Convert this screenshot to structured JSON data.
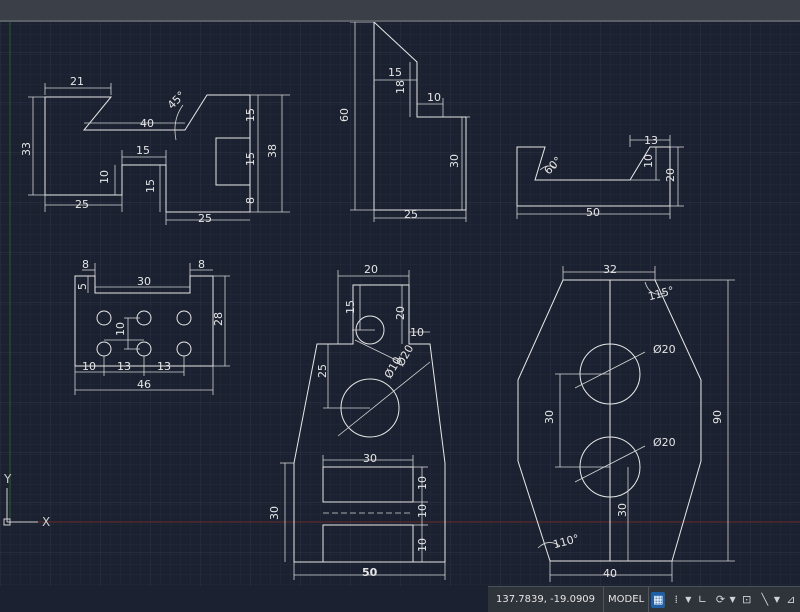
{
  "status": {
    "coordinates": "137.7839, -19.0909",
    "space_mode": "MODEL",
    "buttons": [
      {
        "name": "grid-icon",
        "glyph": "▦",
        "active": true
      },
      {
        "name": "snap-icon",
        "glyph": "⁞",
        "active": false
      },
      {
        "name": "ortho-icon",
        "glyph": "∟",
        "active": false
      },
      {
        "name": "polar-icon",
        "glyph": "⟳",
        "active": false
      },
      {
        "name": "osnap-icon",
        "glyph": "⊡",
        "active": false
      },
      {
        "name": "annotation-icon",
        "glyph": "╲",
        "active": false
      },
      {
        "name": "scale-icon",
        "glyph": "⊿",
        "active": false
      }
    ]
  },
  "ucs": {
    "y_label": "Y",
    "x_label": "X"
  },
  "drawing": {
    "part1": {
      "d21": "21",
      "d40": "40",
      "angle": "45°",
      "d33": "33",
      "d15a": "15",
      "d15b": "15",
      "d38": "38",
      "d15c": "15",
      "d10": "10",
      "d15d": "15",
      "d8": "8",
      "d25a": "25",
      "d25b": "25"
    },
    "part2": {
      "d15": "15",
      "d18": "18",
      "d10": "10",
      "d60": "60",
      "d30": "30",
      "d25": "25"
    },
    "part3": {
      "d13": "13",
      "d10": "10",
      "d20": "20",
      "angle": "60°",
      "d50": "50"
    },
    "part4": {
      "d8a": "8",
      "d5": "5",
      "d30": "30",
      "d8b": "8",
      "d28": "28",
      "d10v": "10",
      "d10h": "10",
      "d13a": "13",
      "d13b": "13",
      "d46": "46"
    },
    "part5": {
      "d20": "20",
      "d15": "15",
      "d20v": "20",
      "d10": "10",
      "d25": "25",
      "dia10": "Ø10",
      "dia20": "Ø20",
      "d30": "30",
      "d10a": "10",
      "d10b": "10",
      "d10c": "10",
      "d30v": "30",
      "d50": "50"
    },
    "part6": {
      "d32": "32",
      "angle1": "115°",
      "dia1": "Ø20",
      "dia2": "Ø20",
      "d30a": "30",
      "d30b": "30",
      "d90": "90",
      "angle2": "110°",
      "d40": "40"
    }
  }
}
